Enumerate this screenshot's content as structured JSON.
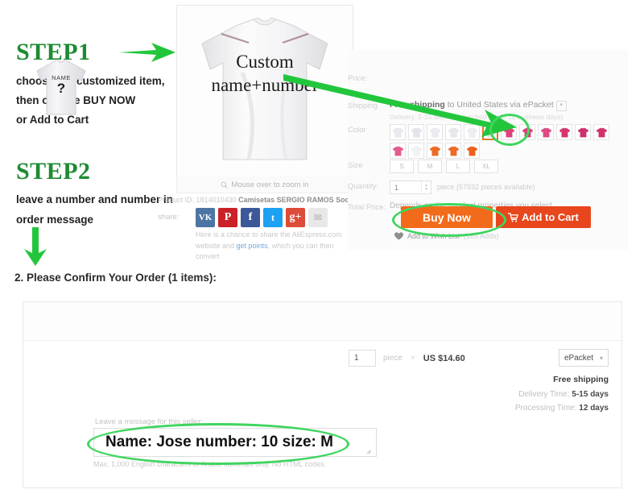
{
  "steps": [
    {
      "title": "STEP1",
      "lines": [
        "choose the customized item,",
        "then choose BUY NOW",
        "or Add to Cart"
      ]
    },
    {
      "title": "STEP2",
      "lines": [
        "leave a number and number in",
        "order message"
      ]
    }
  ],
  "gallery": {
    "overlay_line1": "Custom",
    "overlay_line2": "name+number",
    "zoom_hint": "Mouse over to zoom in",
    "zoom_icon": "magnifier-icon",
    "product_id_label": "Product ID:",
    "product_id_value": "1814010430",
    "product_title": "Camisetas SERGIO RAMOS Soccer ...",
    "share_label": "share:",
    "share_buttons": [
      {
        "name": "vk-icon",
        "glyph": "VK"
      },
      {
        "name": "pinterest-icon",
        "glyph": "P"
      },
      {
        "name": "facebook-icon",
        "glyph": "f"
      },
      {
        "name": "twitter-icon",
        "glyph": "t"
      },
      {
        "name": "google-plus-icon",
        "glyph": "g+"
      },
      {
        "name": "email-icon",
        "glyph": "✉"
      }
    ],
    "share_note_a": "Here is a chance to share the AliExpress.com website and ",
    "share_note_link": "get points",
    "share_note_b": ", which you can then convert"
  },
  "detail": {
    "price_label": "Price:",
    "price_value": "",
    "shipping_label": "Shipping",
    "shipping_free": "Free shipping",
    "shipping_to": " to United States via ePacket",
    "shipping_caret": "▾",
    "shipping_sub": "Delivery: 5-15 days (Dispatched within 12 business days)",
    "color_label": "Color",
    "color_swatches_row1": [
      "#e9e9ee",
      "#e4e4ea",
      "#ececf0",
      "#e7e7ec",
      "#eeeef2",
      "#e3e3e8",
      "#e0407c",
      "#e2387a",
      "#e04a86",
      "#d8336f",
      "#cf2f6a"
    ],
    "color_swatches_row2": [
      "#d62f6c",
      "#e35b90",
      "#f2f2f2",
      "#ef6a23",
      "#ee6a25",
      "#ef5f1b"
    ],
    "selected_swatch_index": 5,
    "size_label": "Size",
    "sizes": [
      "S",
      "M",
      "L",
      "XL"
    ],
    "quantity_label": "Quantity:",
    "quantity_value": "1",
    "quantity_note": "piece (57932 pieces available)",
    "total_price_label": "Total Price:",
    "total_price_value": "Depends on the product properties you select",
    "buy_now_label": "Buy Now",
    "add_to_cart_label": "Add to Cart",
    "cart_icon": "shopping-cart-icon",
    "wish_icon": "heart-icon",
    "wish_label": "Add to Wish List",
    "wish_count": "(189 Adds)"
  },
  "confirm": {
    "heading": "2. Please Confirm Your Order (1 items):",
    "thumb_name": "NAME",
    "thumb_number": "?",
    "quantity_value": "1",
    "piece_label": "piece",
    "times": "×",
    "unit_price": "US $14.60",
    "shipping_method": "ePacket",
    "shipping_caret": "▾",
    "free_shipping": "Free shipping",
    "delivery_label": "Delivery Time:",
    "delivery_value": "5-15 days",
    "processing_label": "Processing Time:",
    "processing_value": "12 days",
    "message_label": "Leave a message for this seller:",
    "message_value": "Name: Jose number: 10 size: M",
    "message_hint": "Max. 1,000 English characters or Arabic numerals only. No HTML codes."
  },
  "annotations": {
    "arrow_color": "#22c63c",
    "highlight_color": "#3fd55f",
    "step_title_color": "#1e8b32",
    "buy_now_color": "#f26b1b",
    "add_cart_color": "#e8461c"
  }
}
